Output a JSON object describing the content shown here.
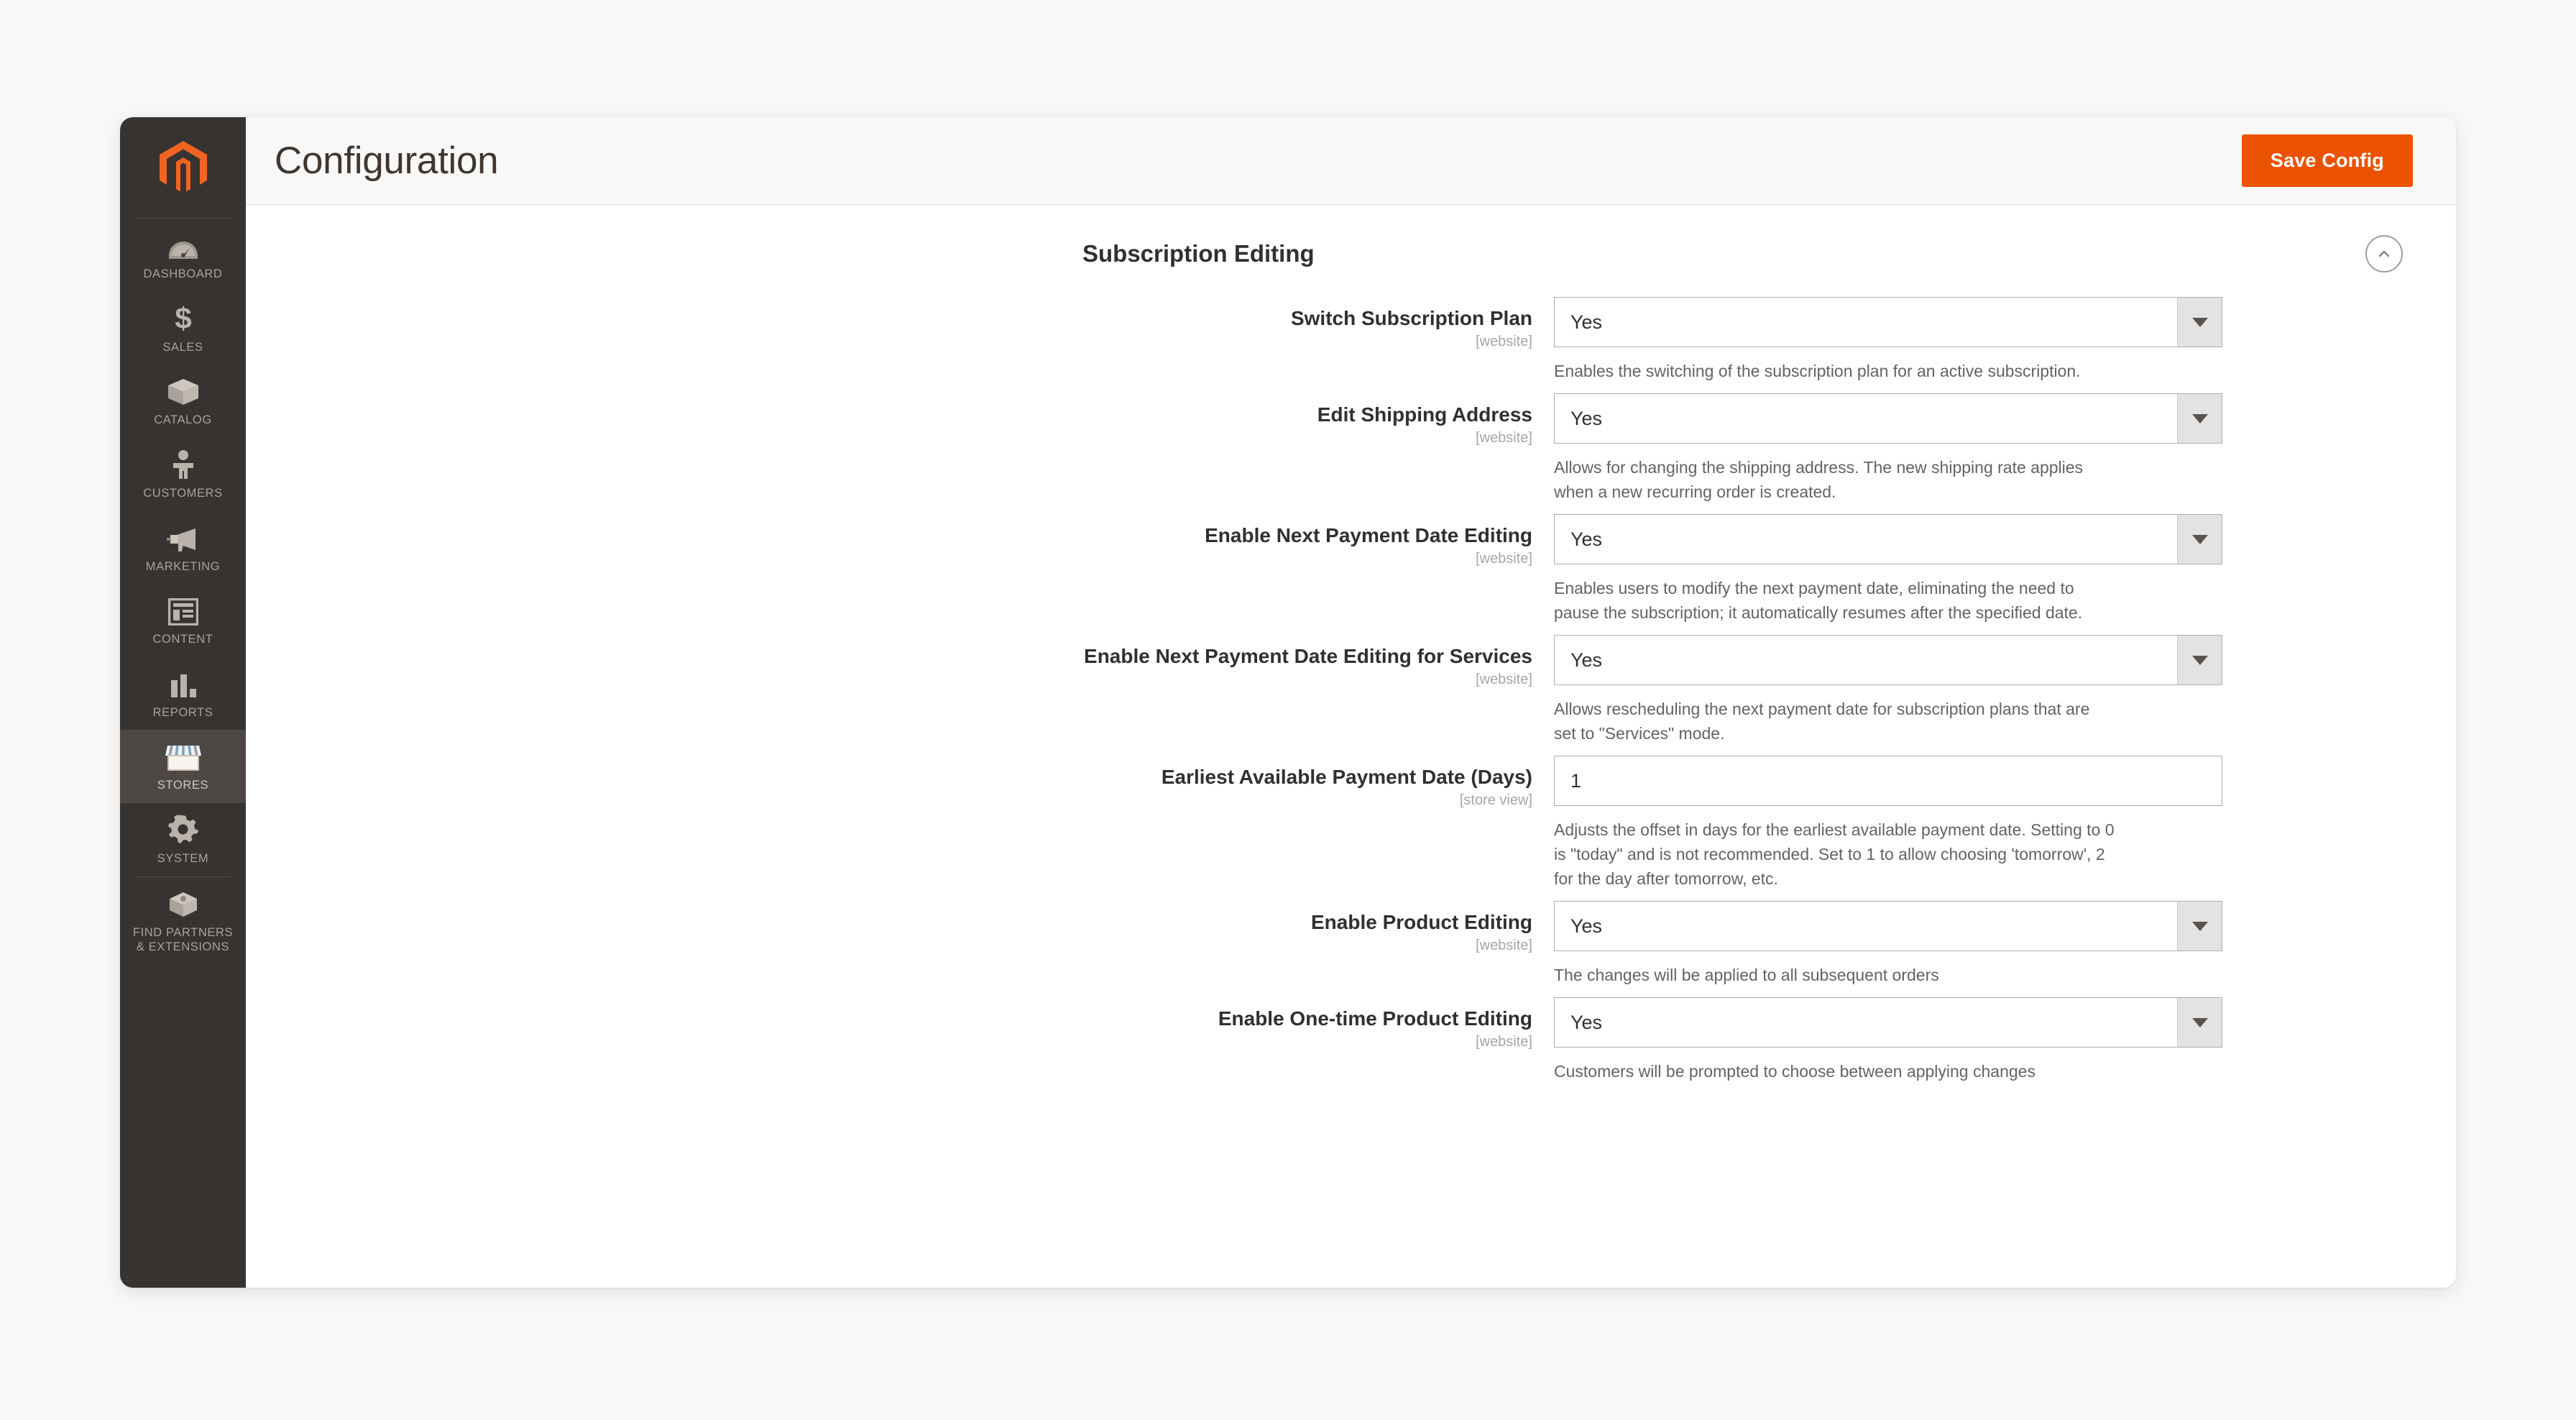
{
  "sidebar": {
    "logo_icon": "magento-logo-icon",
    "items": [
      {
        "label": "Dashboard",
        "icon": "dashboard-gauge-icon",
        "active": false
      },
      {
        "label": "Sales",
        "icon": "dollar-sign-icon",
        "active": false
      },
      {
        "label": "Catalog",
        "icon": "box-icon",
        "active": false
      },
      {
        "label": "Customers",
        "icon": "person-icon",
        "active": false
      },
      {
        "label": "Marketing",
        "icon": "megaphone-icon",
        "active": false
      },
      {
        "label": "Content",
        "icon": "layout-page-icon",
        "active": false
      },
      {
        "label": "Reports",
        "icon": "bar-chart-icon",
        "active": false
      },
      {
        "label": "Stores",
        "icon": "storefront-icon",
        "active": true
      },
      {
        "label": "System",
        "icon": "gear-icon",
        "active": false
      },
      {
        "label": "Find Partners\n& Extensions",
        "icon": "extension-cube-icon",
        "active": false
      }
    ]
  },
  "header": {
    "title": "Configuration",
    "save_label": "Save Config",
    "accent_color": "#eb5202"
  },
  "section": {
    "title": "Subscription Editing",
    "collapse_icon": "chevron-up-circle-icon"
  },
  "fields": [
    {
      "label": "Switch Subscription Plan",
      "scope": "[website]",
      "type": "select",
      "value": "Yes",
      "note": [
        "Enables the switching of the subscription plan for an active subscription."
      ]
    },
    {
      "label": "Edit Shipping Address",
      "scope": "[website]",
      "type": "select",
      "value": "Yes",
      "note": [
        "Allows for changing the shipping address. The new shipping rate applies",
        "when a new recurring order is created."
      ]
    },
    {
      "label": "Enable Next Payment Date Editing",
      "scope": "[website]",
      "type": "select",
      "value": "Yes",
      "note": [
        "Enables users to modify the next payment date, eliminating the need to",
        "pause the subscription; it automatically resumes after the specified date."
      ]
    },
    {
      "label": "Enable Next Payment Date Editing for Services",
      "scope": "[website]",
      "type": "select",
      "value": "Yes",
      "note": [
        "Allows rescheduling the next payment date for subscription plans that are",
        "set to \"Services\" mode."
      ]
    },
    {
      "label": "Earliest Available Payment Date (Days)",
      "scope": "[store view]",
      "type": "text",
      "value": "1",
      "note": [
        "Adjusts the offset in days for the earliest available payment date. Setting to 0",
        "is \"today\" and is not recommended. Set to 1 to allow choosing 'tomorrow', 2",
        "for the day after tomorrow, etc."
      ]
    },
    {
      "label": "Enable Product Editing",
      "scope": "[website]",
      "type": "select",
      "value": "Yes",
      "note": [
        "The changes will be applied to all subsequent orders"
      ]
    },
    {
      "label": "Enable One-time Product Editing",
      "scope": "[website]",
      "type": "select",
      "value": "Yes",
      "note": [
        "Customers will be prompted to choose between applying changes"
      ]
    }
  ]
}
